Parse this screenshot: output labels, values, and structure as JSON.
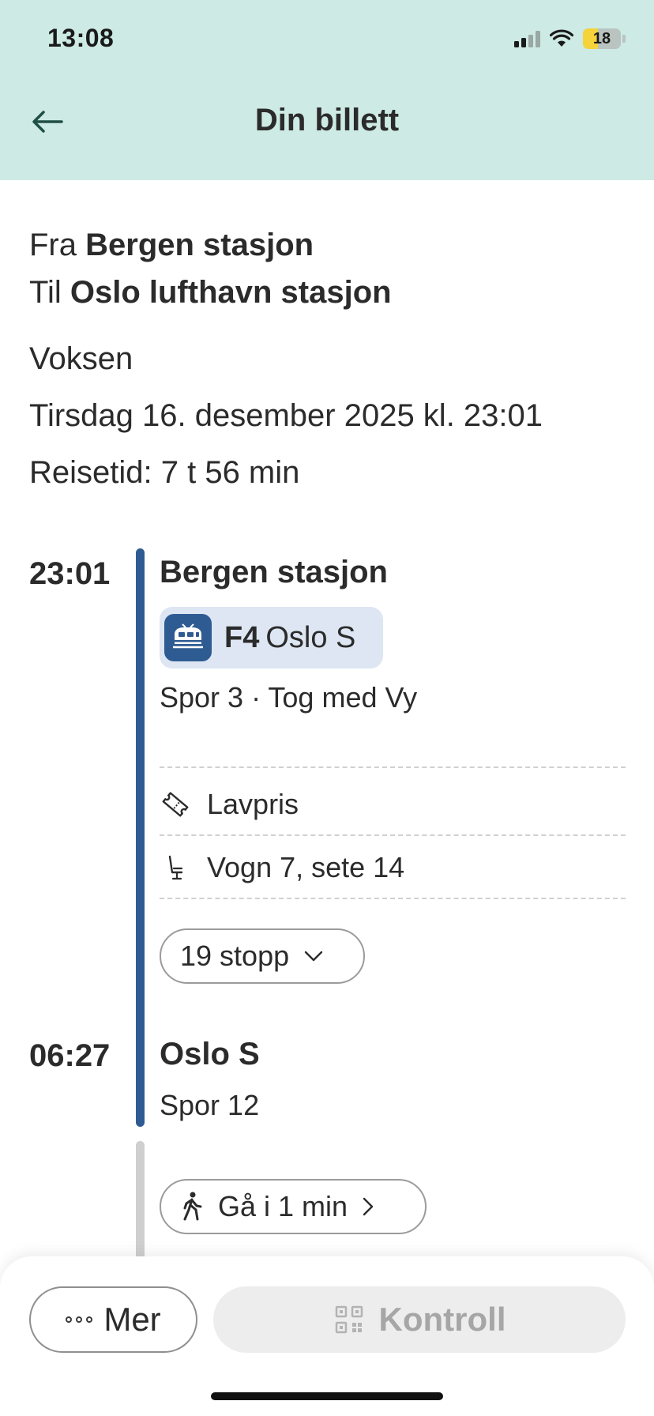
{
  "status_bar": {
    "time": "13:08",
    "battery": "18"
  },
  "header": {
    "title": "Din billett"
  },
  "trip": {
    "from_label": "Fra",
    "from_station": "Bergen stasjon",
    "to_label": "Til",
    "to_station": "Oslo lufthavn stasjon",
    "passenger": "Voksen",
    "datetime": "Tirsdag 16. desember 2025 kl. 23:01",
    "travel_time": "Reisetid: 7 t 56 min"
  },
  "leg": {
    "departure_time": "23:01",
    "departure_station": "Bergen stasjon",
    "line_code": "F4",
    "line_destination": "Oslo S",
    "platform_operator": "Spor 3 · Tog med Vy",
    "ticket_type": "Lavpris",
    "seat": "Vogn 7, sete 14",
    "stops": "19 stopp",
    "arrival_time": "06:27",
    "arrival_station": "Oslo S",
    "arrival_platform": "Spor 12"
  },
  "walk": {
    "label": "Gå i 1 min"
  },
  "actions": {
    "more_label": "Mer",
    "control_label": "Kontroll"
  },
  "colors": {
    "header_bg": "#cdeae4",
    "line_blue": "#2f5b93",
    "chip_bg": "#dde6f2",
    "walk_line": "#cfcfcf"
  },
  "icons": [
    "back-arrow-icon",
    "train-icon",
    "ticket-icon",
    "seat-icon",
    "chevron-down-icon",
    "walk-icon",
    "chevron-right-icon",
    "more-dots-icon",
    "qr-code-icon"
  ]
}
